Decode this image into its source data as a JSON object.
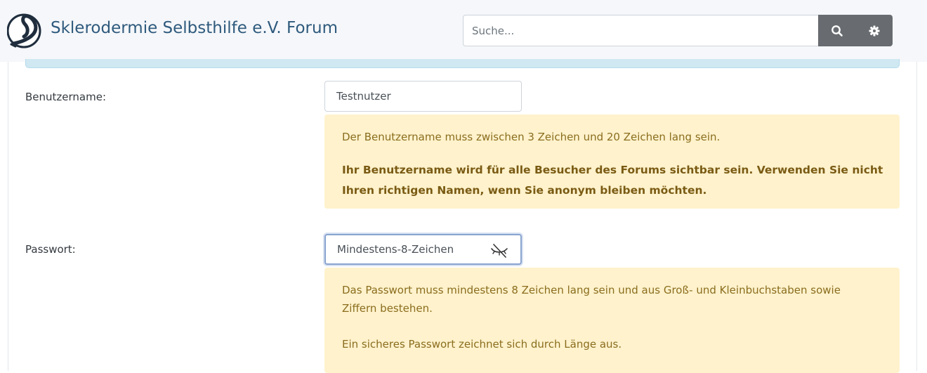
{
  "header": {
    "site_title": "Sklerodermie Selbsthilfe e.V. Forum",
    "search_placeholder": "Suche...",
    "search_icon": "search-icon",
    "settings_icon": "gear-icon",
    "logo_letter": "S"
  },
  "form": {
    "username": {
      "label": "Benutzername:",
      "value": "Testnutzer",
      "hint": "Der Benutzername muss zwischen 3 Zeichen und 20 Zeichen lang sein.",
      "warning": "Ihr Benutzername wird für alle Besucher des Forums sichtbar sein. Verwenden Sie nicht Ihren richtigen Namen, wenn Sie anonym bleiben möchten."
    },
    "password": {
      "label": "Passwort:",
      "value": "Mindestens-8-Zeichen",
      "toggle_icon": "eye-slash-icon",
      "hint": "Das Passwort muss mindestens 8 Zeichen lang sein und aus Groß- und Kleinbuchstaben sowie Ziffern bestehen.",
      "hint2": "Ein sicheres Passwort zeichnet sich durch Länge aus."
    }
  },
  "colors": {
    "title": "#2f5a7d",
    "warning_bg": "#fff2cc",
    "warning_text": "#8a6d1e",
    "button_bg": "#686c70"
  }
}
